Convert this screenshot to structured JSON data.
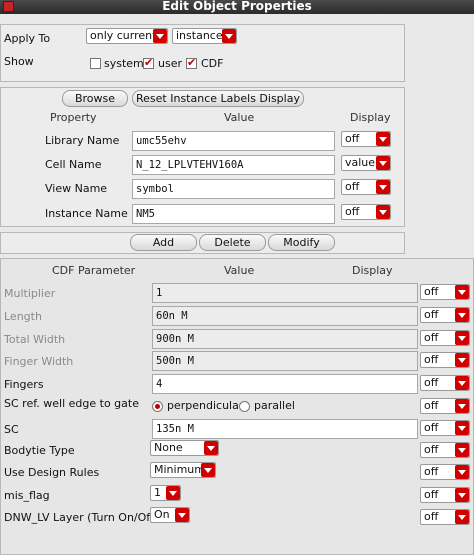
{
  "window": {
    "title": "Edit Object Properties"
  },
  "apply_to": {
    "label": "Apply To",
    "scope": "only current",
    "target": "instance"
  },
  "show": {
    "label": "Show",
    "system": {
      "label": "system",
      "checked": false
    },
    "user": {
      "label": "user",
      "checked": true
    },
    "cdf": {
      "label": "CDF",
      "checked": true
    }
  },
  "toolbar": {
    "browse": "Browse",
    "reset": "Reset Instance Labels Display"
  },
  "property_table": {
    "headers": {
      "property": "Property",
      "value": "Value",
      "display": "Display"
    },
    "rows": [
      {
        "label": "Library Name",
        "value": "umc55ehv",
        "display": "off"
      },
      {
        "label": "Cell Name",
        "value": "N_12_LPLVTEHV160A",
        "display": "value"
      },
      {
        "label": "View Name",
        "value": "symbol",
        "display": "off"
      },
      {
        "label": "Instance Name",
        "value": "NM5",
        "display": "off"
      }
    ]
  },
  "actions": {
    "add": "Add",
    "delete": "Delete",
    "modify": "Modify"
  },
  "cdf_table": {
    "headers": {
      "parameter": "CDF Parameter",
      "value": "Value",
      "display": "Display"
    },
    "rows": [
      {
        "label": "Multiplier",
        "value": "1",
        "display": "off"
      },
      {
        "label": "Length",
        "value": "60n M",
        "display": "off"
      },
      {
        "label": "Total Width",
        "value": "900n M",
        "display": "off"
      },
      {
        "label": "Finger Width",
        "value": "500n M",
        "display": "off"
      },
      {
        "label": "Fingers",
        "value": "4",
        "display": "off"
      },
      {
        "label": "SC ref. well edge to gate",
        "option_a": "perpendicular",
        "option_b": "parallel",
        "selected": "perpendicular",
        "display": "off"
      },
      {
        "label": "SC",
        "value": "135n M",
        "display": "off"
      },
      {
        "label": "Bodytie Type",
        "value": "None",
        "display": "off"
      },
      {
        "label": "Use Design Rules",
        "value": "Minimum",
        "display": "off"
      },
      {
        "label": "mis_flag",
        "value": "1",
        "display": "off"
      },
      {
        "label": "DNW_LV Layer (Turn On/Off)",
        "value": "On",
        "display": "off"
      }
    ]
  },
  "colors": {
    "accent": "#d10000",
    "titlebar": "#333333",
    "background": "#e9e9e9"
  }
}
